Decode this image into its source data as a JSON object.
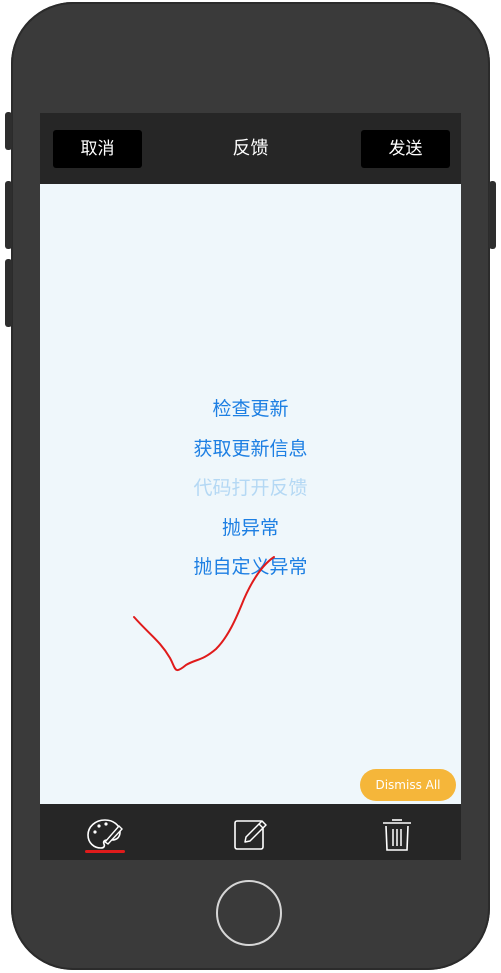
{
  "header": {
    "cancel_label": "取消",
    "title": "反馈",
    "send_label": "发送"
  },
  "menu": {
    "items": [
      {
        "label": "检查更新",
        "enabled": true
      },
      {
        "label": "获取更新信息",
        "enabled": true
      },
      {
        "label": "代码打开反馈",
        "enabled": false
      },
      {
        "label": "抛异常",
        "enabled": true
      },
      {
        "label": "抛自定义异常",
        "enabled": true
      }
    ]
  },
  "dismiss": {
    "label": "Dismiss All"
  },
  "toolbar": {
    "tools": [
      {
        "icon": "palette-icon",
        "selected": true
      },
      {
        "icon": "edit-icon",
        "selected": false
      },
      {
        "icon": "trash-icon",
        "selected": false
      }
    ]
  },
  "colors": {
    "link": "#1d7fe3",
    "link_disabled": "#b4d8f4",
    "stroke": "#e01b1b",
    "dismiss_bg": "#f5b63a",
    "bar_bg": "#262626",
    "screen_bg": "#eff7fb"
  }
}
